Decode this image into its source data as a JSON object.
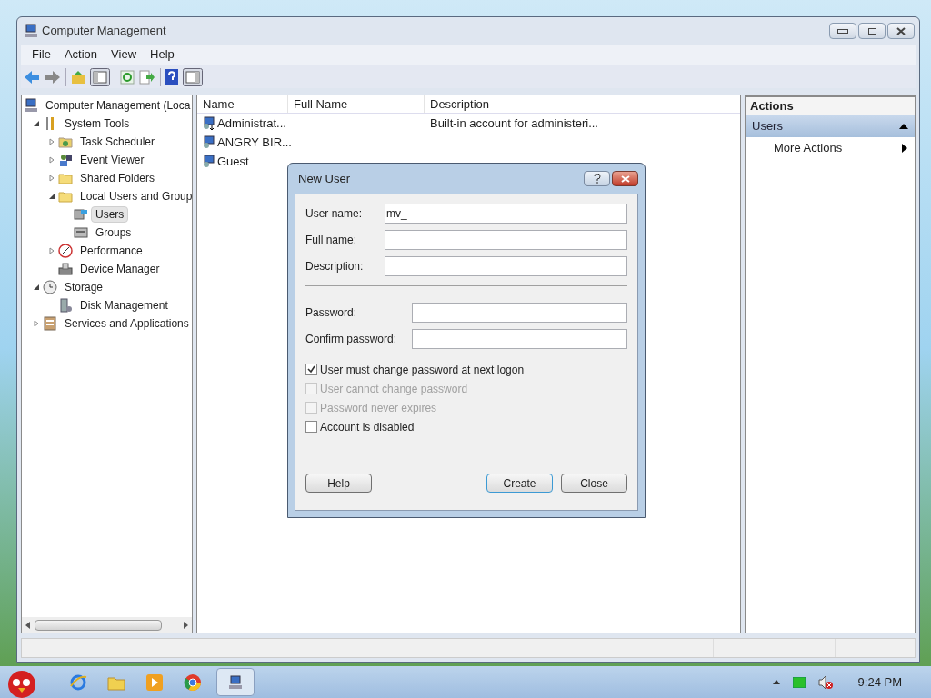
{
  "window": {
    "title": "Computer Management"
  },
  "menu": [
    "File",
    "Action",
    "View",
    "Help"
  ],
  "tree": [
    {
      "label": "Computer Management (Loca",
      "selected": false,
      "children": [
        {
          "label": "System Tools",
          "expanded": true,
          "selected": false,
          "children": [
            {
              "label": "Task Scheduler",
              "expanded": false,
              "selected": false
            },
            {
              "label": "Event Viewer",
              "expanded": false,
              "selected": false
            },
            {
              "label": "Shared Folders",
              "expanded": false,
              "selected": false
            },
            {
              "label": "Local Users and Group",
              "expanded": true,
              "selected": false,
              "children": [
                {
                  "label": "Users",
                  "selected": true
                },
                {
                  "label": "Groups",
                  "selected": false
                }
              ]
            },
            {
              "label": "Performance",
              "expanded": false,
              "selected": false
            },
            {
              "label": "Device Manager",
              "selected": false
            }
          ]
        },
        {
          "label": "Storage",
          "expanded": true,
          "selected": false,
          "children": [
            {
              "label": "Disk Management",
              "selected": false
            }
          ]
        },
        {
          "label": "Services and Applications",
          "expanded": false,
          "selected": false
        }
      ]
    }
  ],
  "table": {
    "columns": [
      "Name",
      "Full Name",
      "Description"
    ],
    "rows": [
      {
        "name": "Administrat...",
        "description": "Built-in account for administeri..."
      },
      {
        "name": "ANGRY BIR..."
      },
      {
        "name": "Guest"
      }
    ]
  },
  "actions": {
    "title": "Actions",
    "section": "Users",
    "items": [
      "More Actions"
    ]
  },
  "dialog": {
    "title": "New User",
    "fields": [
      {
        "label": "User name:",
        "value": "mv_"
      },
      {
        "label": "Full name:"
      },
      {
        "label": "Description:"
      }
    ],
    "password_fields": [
      {
        "label": "Password:"
      },
      {
        "label": "Confirm password:"
      }
    ],
    "options": [
      {
        "label": "User must change password at next logon",
        "checked": true,
        "disabled": false
      },
      {
        "label": "User cannot change password",
        "checked": false,
        "disabled": true
      },
      {
        "label": "Password never expires",
        "checked": false,
        "disabled": true
      },
      {
        "label": "Account is disabled",
        "checked": false,
        "disabled": false
      }
    ],
    "buttons": [
      {
        "label": "Help",
        "default": false
      },
      {
        "label": "Create",
        "default": true
      },
      {
        "label": "Close",
        "default": false
      }
    ]
  },
  "taskbar": {
    "time": "9:24 PM"
  }
}
